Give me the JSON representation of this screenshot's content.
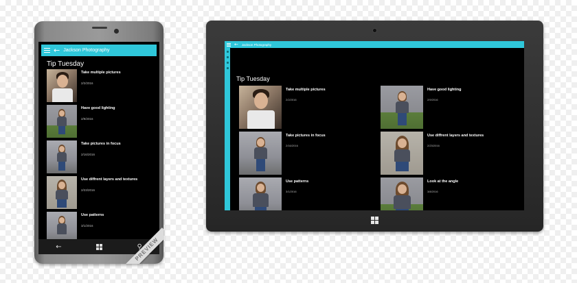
{
  "phone": {
    "app_title": "Jackson Photography",
    "section_title": "Tip Tuesday",
    "items": [
      {
        "title": "Take multiple pictures",
        "date": "2/2/2016",
        "photo": "man-portrait"
      },
      {
        "title": "Have good lighting",
        "date": "2/9/2016",
        "photo": "girl-grass"
      },
      {
        "title": "Take pictures in focus",
        "date": "2/16/2016",
        "photo": "girl-wall"
      },
      {
        "title": "Use diffrent layers and textures",
        "date": "2/23/2016",
        "photo": "girl-stone"
      },
      {
        "title": "Use patterns",
        "date": "3/1/2016",
        "photo": "girl-wall"
      }
    ],
    "nav_icons": [
      "back-arrow-icon",
      "windows-icon",
      "search-icon"
    ],
    "ribbon_text": "PREVIEW"
  },
  "tablet": {
    "app_title": "Jackson Photography",
    "section_title": "Tip Tuesday",
    "left_column": [
      {
        "title": "Take multiple pictures",
        "date": "2/2/2016",
        "photo": "man-portrait"
      },
      {
        "title": "Take pictures in focus",
        "date": "2/16/2016",
        "photo": "girl-wall"
      },
      {
        "title": "Use patterns",
        "date": "3/1/2016",
        "photo": "girl-wall"
      }
    ],
    "right_column": [
      {
        "title": "Have good lighting",
        "date": "2/9/2016",
        "photo": "girl-grass"
      },
      {
        "title": "Use diffrent layers and textures",
        "date": "2/23/2016",
        "photo": "girl-stone"
      },
      {
        "title": "Look at the angle",
        "date": "3/8/2016",
        "photo": "girl-grass"
      }
    ]
  },
  "colors": {
    "accent": "#2fc7da",
    "screen_bg": "#000000",
    "device_dark": "#2b2b2b",
    "phone_body": "#8a8a8a"
  }
}
